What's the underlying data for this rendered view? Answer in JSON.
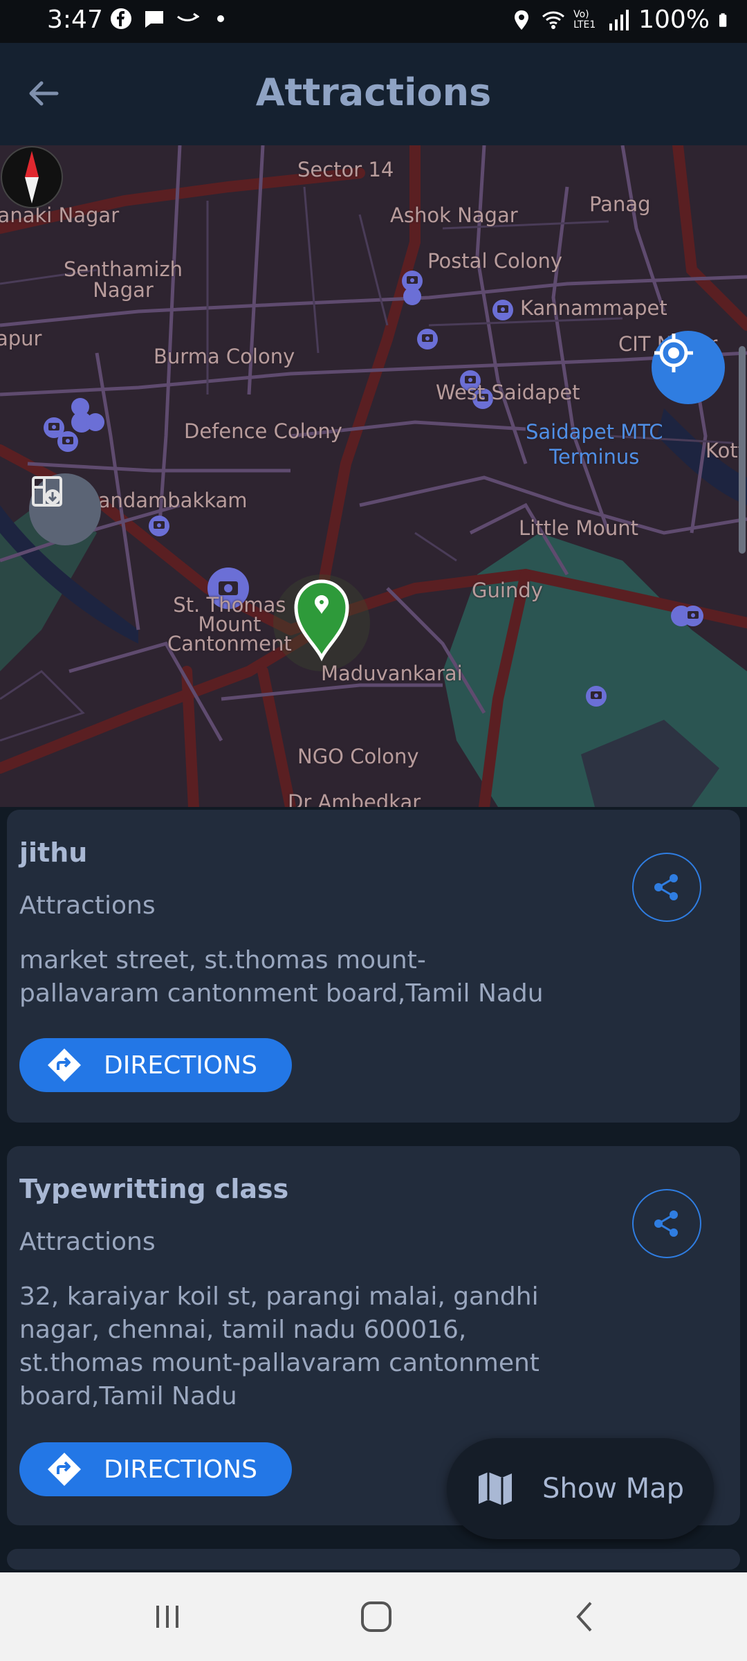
{
  "status_bar": {
    "time": "3:47",
    "battery": "100%",
    "icons": [
      "facebook-icon",
      "message-icon",
      "amazon-icon",
      "dot-icon",
      "location-icon",
      "wifi-icon",
      "volte-icon",
      "signal-icon",
      "battery-icon"
    ],
    "network_label": "Vo) LTE1"
  },
  "app_bar": {
    "title": "Attractions",
    "back_icon": "arrow-left-icon"
  },
  "map": {
    "labels": {
      "sector14": "Sector 14",
      "janaki_nagar": "Janaki Nagar",
      "ashok_nagar": "Ashok Nagar",
      "panag": "Panag",
      "senthamizh_nagar": "Senthamizh\nNagar",
      "postal_colony": "Postal Colony",
      "kannammapet": "Kannammapet",
      "apur": "apur",
      "burma_colony": "Burma Colony",
      "cit_nagar": "CIT Nagar",
      "west_saidapet": "West Saidapet",
      "defence_colony": "Defence Colony",
      "saidapet_mtc": "Saidapet MTC\nTerminus",
      "kott": "Kott",
      "nandambakkam": "Nandambakkam",
      "little_mount": "Little Mount",
      "guindy": "Guindy",
      "st_thomas": "St. Thomas\nMount\nCantonment",
      "maduvankarai": "Maduvankarai",
      "ngo_colony": "NGO Colony",
      "dr_ambedkar": "Dr Ambedkar"
    },
    "colors": {
      "accent": "#2f7de1",
      "marker": "#2e9a3a",
      "poi": "#6b6fd6"
    }
  },
  "results": [
    {
      "name": "jithu",
      "category": "Attractions",
      "address": "market street, st.thomas mount-pallavaram cantonment board,Tamil Nadu",
      "directions_label": "DIRECTIONS"
    },
    {
      "name": "Typewritting class",
      "category": "Attractions",
      "address": "32, karaiyar koil st, parangi malai, gandhi nagar, chennai, tamil nadu 600016, st.thomas mount-pallavaram cantonment board,Tamil Nadu",
      "directions_label": "DIRECTIONS"
    }
  ],
  "show_map": {
    "label": "Show Map"
  },
  "nav_bar": {
    "icons": [
      "recents-icon",
      "home-icon",
      "back-icon"
    ]
  }
}
